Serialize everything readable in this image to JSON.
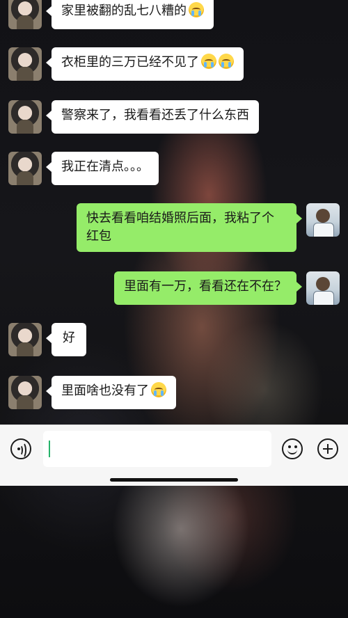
{
  "messages": [
    {
      "side": "left",
      "text": "家里被翻的乱七八糟的",
      "emoji": [
        "crying-face"
      ]
    },
    {
      "side": "left",
      "text": "衣柜里的三万已经不见了",
      "emoji": [
        "crying-face",
        "crying-face"
      ]
    },
    {
      "side": "left",
      "text": "警察来了，我看看还丢了什么东西",
      "emoji": []
    },
    {
      "side": "left",
      "text": "我正在清点。。。",
      "emoji": []
    },
    {
      "side": "right",
      "text_line1": "快去看看咱结婚照后面，我粘了个",
      "text_line2": "红包"
    },
    {
      "side": "right",
      "text": "里面有一万，看看还在不在？"
    },
    {
      "side": "left",
      "text": "好",
      "emoji": []
    },
    {
      "side": "left",
      "text": "里面啥也没有了",
      "emoji": [
        "crying-face"
      ]
    }
  ],
  "input_bar": {
    "placeholder": "",
    "value": "",
    "caret_color": "#27b36a",
    "icons": [
      "voice-icon",
      "emoji-icon",
      "plus-icon"
    ]
  },
  "colors": {
    "sent_bubble": "#95ec69",
    "received_bubble": "#ffffff",
    "input_bar_bg": "#f6f6f6"
  }
}
